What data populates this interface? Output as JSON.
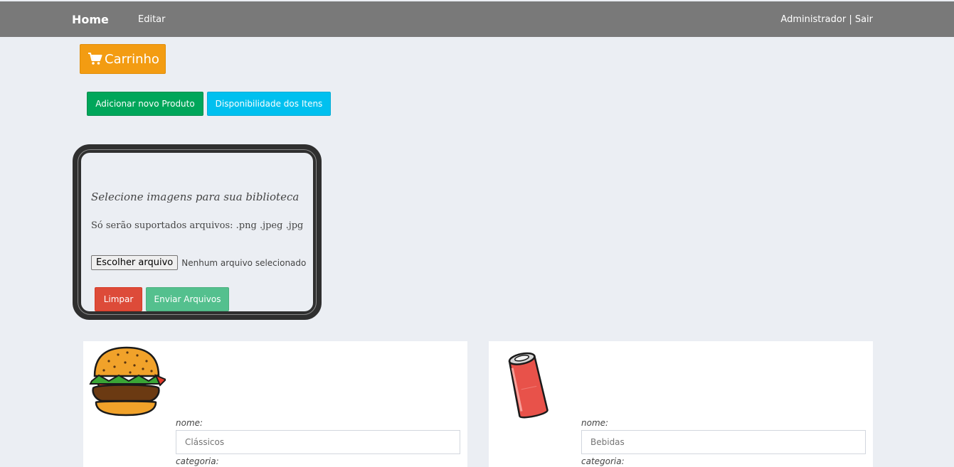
{
  "nav": {
    "brand": "Home",
    "edit": "Editar",
    "user": "Administrador | Sair"
  },
  "cart": {
    "label": "Carrinho",
    "icon": "shopping-cart-icon",
    "color": "#f39c12"
  },
  "actions": {
    "add_product": "Adicionar novo Produto",
    "availability": "Disponibilidade dos Itens"
  },
  "upload": {
    "title": "Selecione imagens para sua biblioteca",
    "note": "Só serão suportados arquivos: .png .jpeg .jpg",
    "file_button": "Escolher arquivo",
    "file_status": "Nenhum arquivo selecionado",
    "clear": "Limpar",
    "send": "Enviar Arquivos"
  },
  "products": [
    {
      "image": "hamburger-icon",
      "name_label": "nome:",
      "name_value": "Clássicos",
      "category_label": "categoria:"
    },
    {
      "image": "soda-can-icon",
      "name_label": "nome:",
      "name_value": "Bebidas",
      "category_label": "categoria:"
    }
  ],
  "colors": {
    "topbar": "#797979",
    "success": "#00a65a",
    "info": "#00c0ef",
    "danger": "#dd4b39",
    "send": "#54c08e",
    "background": "#ebeef3"
  }
}
